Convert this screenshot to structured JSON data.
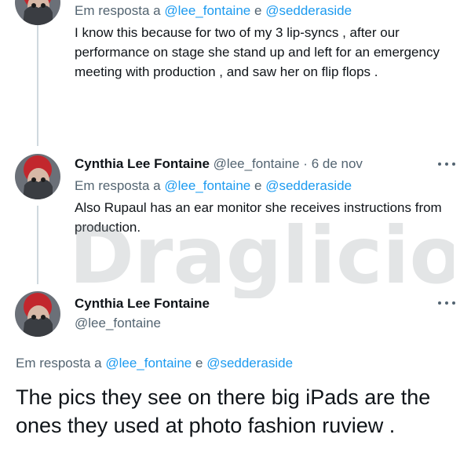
{
  "tweet_top": {
    "reply_prefix": "Em resposta a",
    "mention_1": "@lee_fontaine",
    "conjunction": "e",
    "mention_2": "@sedderaside",
    "text": "I know this because for two of my 3 lip-syncs , after our performance on stage she stand up and left for an emergency meeting with production , and saw her on flip flops ."
  },
  "tweet_middle": {
    "name": "Cynthia Lee Fontaine",
    "handle": "@lee_fontaine",
    "separator": "·",
    "date": "6 de nov",
    "reply_prefix": "Em resposta a",
    "mention_1": "@lee_fontaine",
    "conjunction": "e",
    "mention_2": "@sedderaside",
    "text": "Also Rupaul has an ear monitor she receives instructions from production."
  },
  "tweet_main": {
    "name": "Cynthia Lee Fontaine",
    "handle": "@lee_fontaine",
    "reply_prefix": "Em resposta a",
    "mention_1": "@lee_fontaine",
    "conjunction": "e",
    "mention_2": "@sedderaside",
    "text": "The pics they see on there big iPads are the ones they used at photo fashion ruview ."
  },
  "watermark": {
    "text": "Draglicious"
  },
  "colors": {
    "link": "#1d9bf0",
    "secondary_text": "#536471",
    "thread_line": "#cfd9de"
  },
  "icons": {
    "more": "more-horizontal-icon"
  }
}
